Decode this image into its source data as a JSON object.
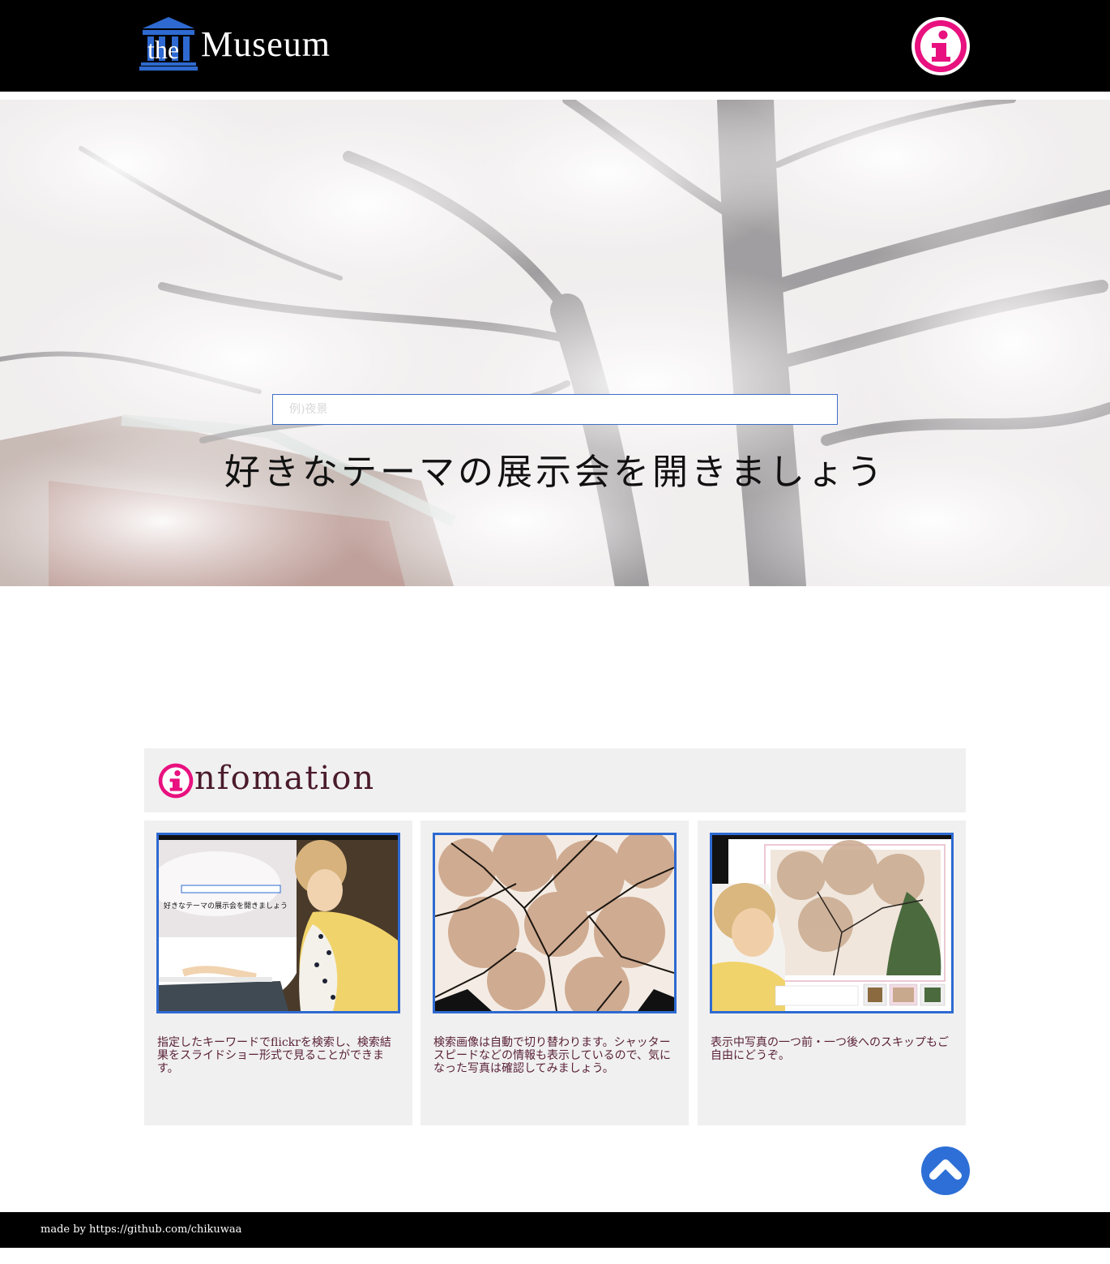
{
  "header": {
    "logo_prefix": "the",
    "logo_text": "Museum",
    "info_icon": "info-icon"
  },
  "hero": {
    "search_placeholder": "例)夜景",
    "title": "好きなテーマの展示会を開きましょう"
  },
  "info": {
    "heading": "nfomation",
    "cards": [
      {
        "desc": "指定したキーワードでflickrを検索し、検索結果をスライドショー形式で見ることができます。"
      },
      {
        "desc": "検索画像は自動で切り替わります。シャッタースピードなどの情報も表示しているので、気になった写真は確認してみましょう。"
      },
      {
        "desc": "表示中写真の一つ前・一つ後へのスキップもご自由にどうぞ。"
      }
    ]
  },
  "thumb1": {
    "mini_title": "好きなテーマの展示会を開きましょう"
  },
  "footer": {
    "credit": "made by https://github.com/chikuwaa"
  },
  "colors": {
    "accent_blue": "#2e6ad1",
    "info_pink": "#e8117f",
    "header_bg": "#000000"
  }
}
